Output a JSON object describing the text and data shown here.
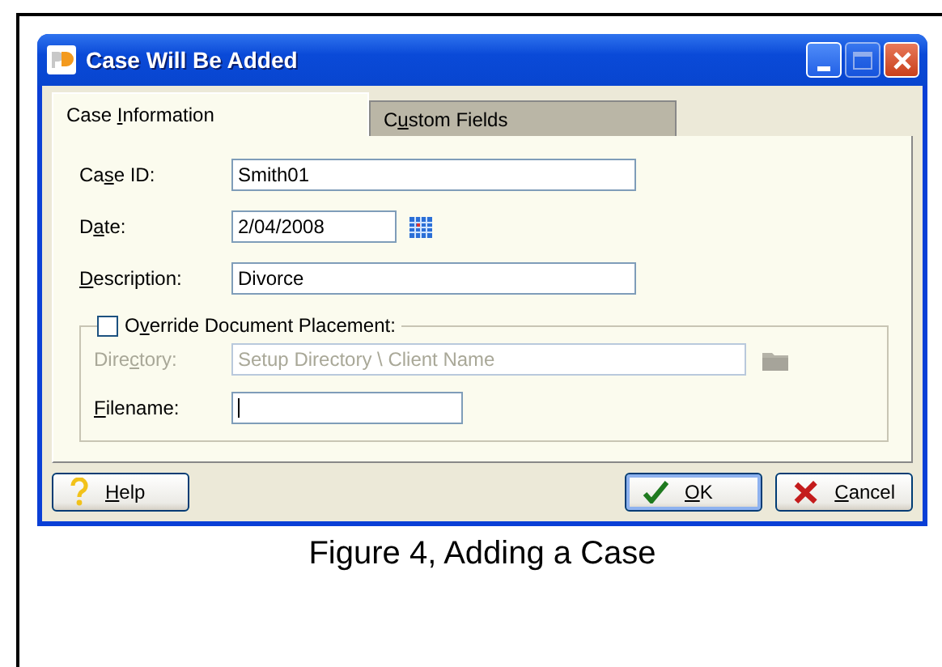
{
  "caption": "Figure 4, Adding a Case",
  "window": {
    "title": "Case Will Be Added",
    "controls": [
      {
        "kind": "minimize",
        "disabled": false
      },
      {
        "kind": "maximize",
        "disabled": true
      },
      {
        "kind": "close",
        "disabled": false
      }
    ]
  },
  "tabs": [
    {
      "label": {
        "pre": "Case ",
        "key": "I",
        "post": "nformation"
      },
      "selected": true
    },
    {
      "label": {
        "pre": "C",
        "key": "u",
        "post": "stom Fields"
      },
      "selected": false
    }
  ],
  "fields": [
    {
      "kind": "text",
      "label": {
        "pre": "Ca",
        "key": "s",
        "post": "e ID:"
      },
      "value": "Smith01"
    },
    {
      "kind": "date",
      "label": {
        "pre": "D",
        "key": "a",
        "post": "te:"
      },
      "value": "2/04/2008"
    },
    {
      "kind": "text",
      "label": {
        "key": "D",
        "post": "escription:"
      },
      "value": "Divorce"
    }
  ],
  "override": {
    "label": {
      "pre": "O",
      "key": "v",
      "post": "erride Document Placement:"
    },
    "checked": false
  },
  "group_fields": [
    {
      "kind": "path",
      "label": {
        "pre": "Dire",
        "key": "c",
        "post": "tory:"
      },
      "value": "Setup Directory \\ Client Name",
      "disabled": true,
      "focused": false
    },
    {
      "kind": "file",
      "label": {
        "key": "F",
        "post": "ilename:"
      },
      "disabled": false,
      "focused": true
    }
  ],
  "buttons": [
    {
      "kind": "help",
      "label": {
        "key": "H",
        "post": "elp"
      },
      "default": false
    },
    {
      "kind": "ok",
      "label": {
        "key": "O",
        "post": "K"
      },
      "default": true
    },
    {
      "kind": "cancel",
      "label": {
        "key": "C",
        "post": "ancel"
      },
      "default": false
    }
  ]
}
